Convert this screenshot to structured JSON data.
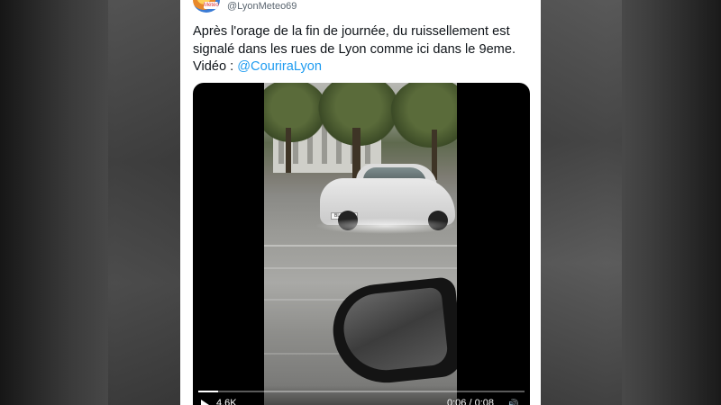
{
  "tweet": {
    "handle": "@LyonMeteo69",
    "avatar_tag": "Météo",
    "text_line_1": "Après l'orage de la fin de journée, du ruissellement est",
    "text_line_2": "signalé dans les rues de Lyon comme ici dans le 9eme.",
    "text_line_3_prefix": "Vidéo : ",
    "mention": "@CouriraLyon"
  },
  "video": {
    "plate_text": "BL-JM-JS",
    "views": "4.6K",
    "time": "0:06 / 0:08",
    "progress_percent": 6,
    "volume_icon": "volume-icon"
  },
  "colors": {
    "mention": "#1d9bf0",
    "text": "#0f1419",
    "handle": "#5b6670"
  }
}
